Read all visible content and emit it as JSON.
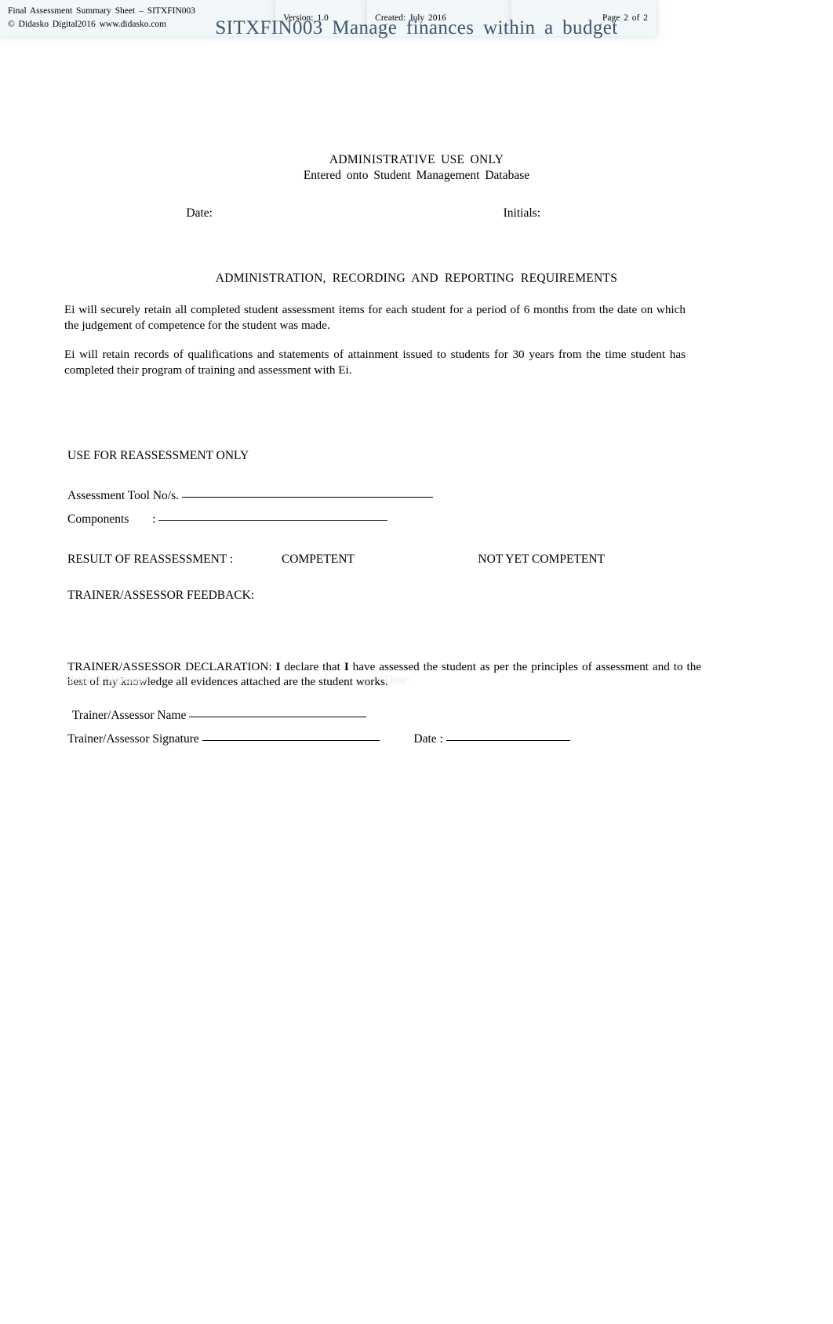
{
  "header": {
    "title": "SITXFIN003  Manage  finances   within  a  budget"
  },
  "admin_section": {
    "title_line_1": "ADMINISTRATIVE  USE  ONLY",
    "title_line_2": "Entered  onto Student   Management   Database",
    "fields": {
      "date_label": "Date:",
      "date_value": "",
      "initials_label": "Initials:",
      "initials_value": ""
    }
  },
  "requirements": {
    "title": "ADMINISTRATION,  RECORDING  AND REPORTING   REQUIREMENTS",
    "paragraph_1": "Ei will securely   retain  all completed   student   assessment    items  for each  student   for a period  of 6 months  from the date  on which  the judgement   of competence    for the  student   was  made.",
    "paragraph_2": "Ei will retain  records   of qualifications   and  statements    of attainment   issued  to students   for 30  years  from the time student  has  completed   their  program  of training  and  assessment    with  Ei."
  },
  "reassessment": {
    "box_title": "USE  FOR  REASSESSMENT    ONLY",
    "assessment_tool_label": "Assessment      Tool  No/s.",
    "assessment_tool_value": "",
    "components_label": "Components",
    "components_separator": ":",
    "components_value": "",
    "result_label": "RESULT  OF REASSESSMENT    :",
    "result_option_competent": "COMPETENT",
    "result_option_not_yet_competent": "NOT  YET COMPETENT",
    "feedback_label": "TRAINER/ASSESSOR     FEEDBACK:",
    "feedback_value": "",
    "declaration_prefix": "TRAINER/ASSESSOR    DECLARATION:",
    "declaration_body_1": "declare   that",
    "declaration_bold_1": "I",
    "declaration_bold_2": "I",
    "declaration_body_2": "have  assessed    the student   as per  the principles   of assessment    and  to  the  best  of my knowledge   all evidences    attached    are  the  student   works.",
    "trainer_name_label": "Trainer/Assessor     Name",
    "trainer_name_value": "",
    "trainer_signature_label": "Trainer/Assessor     Signature",
    "trainer_signature_value": "",
    "trainer_date_label": "Date  :",
    "trainer_date_value": ""
  },
  "ghost_text": {
    "student_signature": "Student   Signature",
    "date": "Date:"
  },
  "footer": {
    "doc_name": "Final  Assessment    Summary   Sheet  – SITXFIN003",
    "copyright": "© Didasko  Digital2016  www.didasko.com",
    "version": "Version:  1.0",
    "created": "Created:   July  2016",
    "page": "Page  2 of 2"
  },
  "colors": {
    "header_blue": "#3d556e",
    "footer_bg": "#f2f7f9",
    "ghost": "#ececed"
  }
}
